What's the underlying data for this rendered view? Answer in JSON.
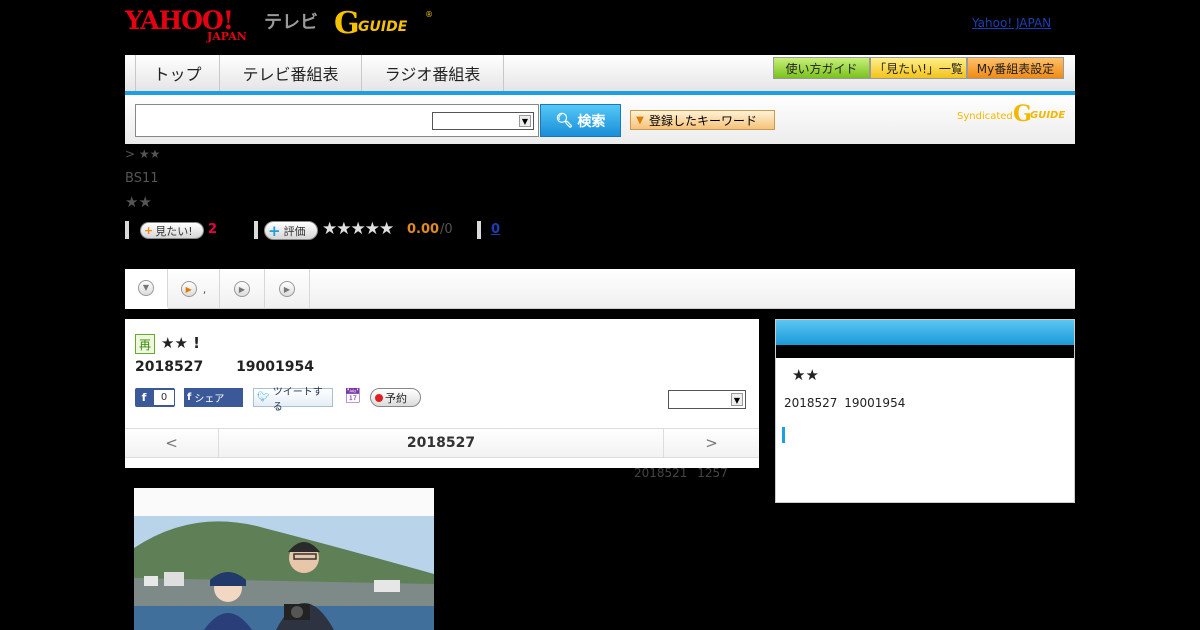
{
  "header": {
    "yahoo_logo_top": "YAHOO!",
    "yahoo_logo_bottom": "JAPAN",
    "tv_logo": "テレビ",
    "gguide_g": "G",
    "gguide_text": "GUIDE",
    "gguide_reg": "®",
    "yahoo_link": "Yahoo! JAPAN"
  },
  "nav": {
    "tabs": [
      "トップ",
      "テレビ番組表",
      "ラジオ番組表"
    ],
    "guide_button": "使い方ガイド",
    "mitai_button": "「見たい!」一覧",
    "my_button": "My番組表設定"
  },
  "search": {
    "input_value": "",
    "select_value": "",
    "button_label": "検索",
    "keyword_button": "登録したキーワード",
    "syndicated": "Syndicated",
    "syn_g": "G",
    "syn_guide": "GUIDE"
  },
  "program": {
    "breadcrumb": "> ★★",
    "channel": "BS11",
    "title": "★★",
    "mitai_label": "見たい!",
    "mitai_count": "2",
    "hyoka_label": "評価",
    "stars": "★★★★★",
    "rating": "0.00",
    "rating_count": "/0",
    "review_count": "0"
  },
  "tabs": {
    "tab2_suffix": ","
  },
  "episode": {
    "rerun_badge": "再",
    "title": "★★ !",
    "date": "2018527 19001954",
    "fb_like_count": "0",
    "fb_share": "シェア",
    "tweet": "ツイートする",
    "reserve": "予約",
    "select_value": ""
  },
  "date_nav": {
    "prev": "<",
    "current": "2018527",
    "next": ">"
  },
  "updated": "2018521 1257",
  "side": {
    "title": "★★",
    "date": "2018527 19001954"
  },
  "colors": {
    "accent_blue": "#1d9fe0",
    "yahoo_red": "#e60012",
    "gguide_yellow": "#f6c200"
  }
}
